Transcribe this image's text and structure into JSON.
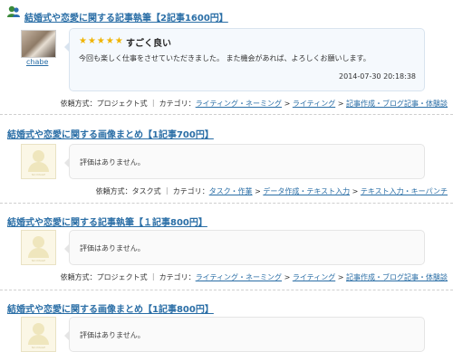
{
  "entries": [
    {
      "title": "結婚式や恋愛に関する記事執筆【2記事1600円】",
      "user": "chabe",
      "rating_stars": "★★★★★",
      "rating_label": "すごく良い",
      "comment": "今回も楽しく仕事をさせていただきました。 また機会があれば、よろしくお願いします。",
      "date": "2014-07-30 20:18:38",
      "meta_prefix": "依頼方式：プロジェクト式 ｜ カテゴリ：",
      "categories": [
        "ライティング・ネーミング",
        "ライティング",
        "記事作成・ブログ記事・体験談"
      ]
    },
    {
      "title": "結婚式や恋愛に関する画像まとめ【1記事700円】",
      "no_review": "評価はありません。",
      "placeholder": "NO IMAGE",
      "meta_prefix": "依頼方式：タスク式 ｜ カテゴリ：",
      "categories": [
        "タスク・作業",
        "データ作成・テキスト入力",
        "テキスト入力・キーパンチ"
      ]
    },
    {
      "title": "結婚式や恋愛に関する記事執筆【１記事800円】",
      "no_review": "評価はありません。",
      "placeholder": "NO IMAGE",
      "meta_prefix": "依頼方式：プロジェクト式 ｜ カテゴリ：",
      "categories": [
        "ライティング・ネーミング",
        "ライティング",
        "記事作成・ブログ記事・体験談"
      ]
    },
    {
      "title": "結婚式や恋愛に関する画像まとめ【1記事800円】",
      "no_review": "評価はありません。",
      "placeholder": "NO IMAGE"
    }
  ],
  "separator": ">",
  "colors": {
    "link": "#2a6ea6",
    "star": "#f0b400"
  },
  "icons": {
    "user_icon": "person-icon",
    "placeholder": "no-image-avatar"
  }
}
